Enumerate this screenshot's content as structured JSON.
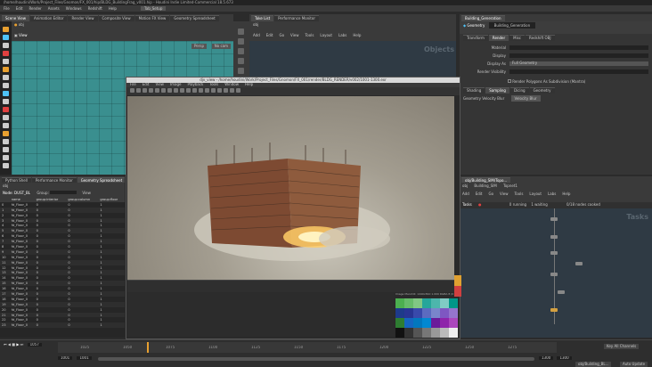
{
  "window": {
    "title": "/home/houdini/Work/Project_Files/Gnomon/FX_001/hip/BLDG_BuildingFrag_v001.hip - Houdini Indie Limited-Commercial 18.5.673",
    "menu": [
      "File",
      "Edit",
      "Render",
      "Assets",
      "Windows",
      "Redshift",
      "Help"
    ],
    "desktop": "Tab_Setup"
  },
  "viewport_tabs": [
    "Scene View",
    "Animation Editor",
    "Render View",
    "Composite View",
    "Motion FX View",
    "Geometry Spreadsheet"
  ],
  "viewport": {
    "path": "obj",
    "label": "View",
    "persp": "Persp",
    "cam": "No cam"
  },
  "network_tabs": [
    "Take List",
    "Performance Monitor"
  ],
  "network": {
    "path": "obj",
    "menu": [
      "Add",
      "Edit",
      "Go",
      "View",
      "Tools",
      "Layout",
      "Labs",
      "Help"
    ],
    "watermark": "Objects"
  },
  "params": {
    "tabs": [
      "Building_Generation"
    ],
    "node_type": "Geometry",
    "node_name": "Building_Generation",
    "subtabs": [
      "Transform",
      "Render",
      "Misc",
      "Redshift OBJ"
    ],
    "rows": [
      {
        "label": "Material",
        "value": ""
      },
      {
        "label": "Display",
        "value": ""
      },
      {
        "label": "Display As",
        "value": "Full Geometry"
      },
      {
        "label": "Render Visibility",
        "value": ""
      }
    ],
    "checkbox": "Render Polygons As Subdivision (Mantra)",
    "subtabs2": [
      "Shading",
      "Sampling",
      "Dicing",
      "Geometry"
    ],
    "velocity_label": "Geometry Velocity Blur",
    "velocity_value": "Velocity Blur"
  },
  "spreadsheet": {
    "tabs": [
      "Python Shell",
      "Performance Monitor",
      "Geometry Spreadsheet"
    ],
    "path": "obj",
    "node": "Node: DUST_BL",
    "group": "Group:",
    "view": "View",
    "columns": [
      "",
      "name",
      "group:interior",
      "group:column",
      "group:floor"
    ],
    "rows": [
      [
        "0",
        "fd_Floor_0",
        "0",
        "0",
        "1"
      ],
      [
        "1",
        "fd_Floor_0",
        "0",
        "0",
        "1"
      ],
      [
        "2",
        "fd_Floor_0",
        "0",
        "0",
        "1"
      ],
      [
        "3",
        "fd_Floor_0",
        "0",
        "0",
        "1"
      ],
      [
        "4",
        "fd_Floor_0",
        "0",
        "0",
        "1"
      ],
      [
        "5",
        "fd_Floor_0",
        "0",
        "0",
        "1"
      ],
      [
        "6",
        "fd_Floor_0",
        "0",
        "0",
        "1"
      ],
      [
        "7",
        "fd_Floor_0",
        "0",
        "0",
        "1"
      ],
      [
        "8",
        "fd_Floor_0",
        "0",
        "0",
        "1"
      ],
      [
        "9",
        "fd_Floor_0",
        "0",
        "0",
        "1"
      ],
      [
        "10",
        "fd_Floor_0",
        "0",
        "0",
        "1"
      ],
      [
        "11",
        "fd_Floor_0",
        "0",
        "0",
        "1"
      ],
      [
        "12",
        "fd_Floor_0",
        "0",
        "0",
        "1"
      ],
      [
        "13",
        "fd_Floor_0",
        "0",
        "0",
        "1"
      ],
      [
        "14",
        "fd_Floor_0",
        "0",
        "0",
        "1"
      ],
      [
        "15",
        "fd_Floor_0",
        "0",
        "0",
        "1"
      ],
      [
        "16",
        "fd_Floor_0",
        "0",
        "0",
        "1"
      ],
      [
        "17",
        "fd_Floor_0",
        "0",
        "0",
        "1"
      ],
      [
        "18",
        "fd_Floor_0",
        "0",
        "0",
        "1"
      ],
      [
        "19",
        "fd_Floor_0",
        "0",
        "0",
        "1"
      ],
      [
        "20",
        "fd_Floor_0",
        "0",
        "0",
        "1"
      ],
      [
        "21",
        "fd_Floor_0",
        "0",
        "0",
        "1"
      ],
      [
        "22",
        "fd_Floor_0",
        "0",
        "0",
        "1"
      ],
      [
        "23",
        "fd_Floor_0",
        "0",
        "0",
        "1"
      ]
    ]
  },
  "mplay": {
    "title": "djv_view - /home/houdini/Work/Project_Files/Gnomon/FX_001/render/BLDG_RENDER/v002/1001-1300.exr",
    "menu": [
      "File",
      "Edit",
      "View",
      "Image",
      "Playback",
      "Tools",
      "Window",
      "Help"
    ],
    "swatch_label": "Image Mandrill: 1440x810  1.000  RGBA 8 (0 0 0)",
    "swatches": [
      "#4caf50",
      "#66bb6a",
      "#81c784",
      "#26a69a",
      "#4db6ac",
      "#80cbc4",
      "#009688",
      "#1e3a8a",
      "#283593",
      "#3949ab",
      "#5c6bc0",
      "#7986cb",
      "#7e57c2",
      "#9575cd",
      "#2e7d32",
      "#1565c0",
      "#0277bd",
      "#0288d1",
      "#6a1b9a",
      "#8e24aa",
      "#ab47bc",
      "#111111",
      "#333333",
      "#555555",
      "#777777",
      "#999999",
      "#bbbbbb",
      "#eeeeee"
    ],
    "side_swatches": [
      "#e0a030",
      "#d04040"
    ]
  },
  "tasks_panel": {
    "tabs": [
      "obj/Building_SIM/Topo..."
    ],
    "path": "obj",
    "sub_path": "Building_SIM",
    "sub_path2": "Topnet1",
    "menu": [
      "Add",
      "Edit",
      "Go",
      "View",
      "Tools",
      "Layout",
      "Labs",
      "Help"
    ],
    "tasks_label": "Tasks",
    "status_running": "0 running",
    "status_waiting": "1 waiting",
    "status_cooked": "0/18 nodes cooked",
    "watermark": "Tasks"
  },
  "timeline": {
    "current_frame": "1057",
    "start": "1001",
    "start2": "1001",
    "end": "1300",
    "end2": "1300",
    "ticks": [
      "1025",
      "1050",
      "1075",
      "1100",
      "1125",
      "1150",
      "1175",
      "1200",
      "1225",
      "1250",
      "1275"
    ],
    "auto_update": "Auto Update",
    "key_all": "Key All Channels",
    "obj_path": "obj/Building_BL..."
  },
  "colors": {
    "accent": "#e8a030",
    "viewport": "#3a8f8f",
    "selection": "#4a7fbf"
  }
}
